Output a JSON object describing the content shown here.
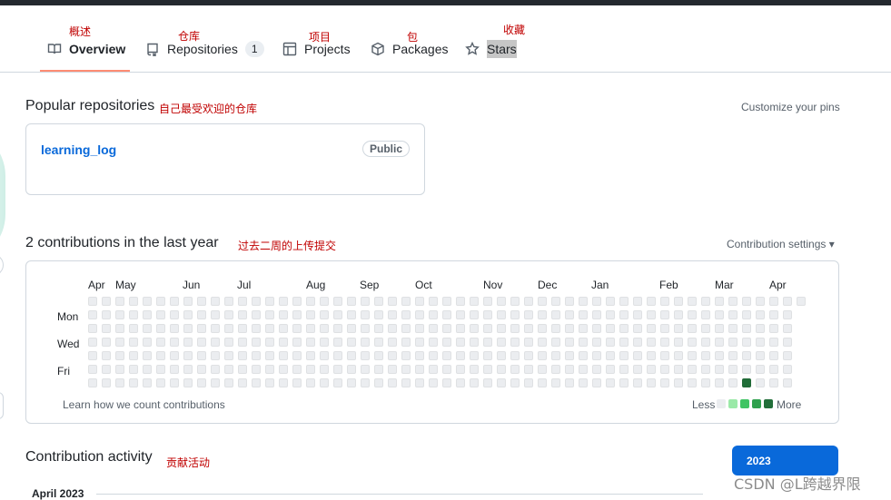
{
  "nav": {
    "tabs": [
      {
        "label": "Overview",
        "annotation": "概述"
      },
      {
        "label": "Repositories",
        "count": "1",
        "annotation": "仓库"
      },
      {
        "label": "Projects",
        "annotation": "项目"
      },
      {
        "label": "Packages",
        "annotation": "包"
      },
      {
        "label": "Stars",
        "annotation": "收藏"
      }
    ]
  },
  "popular": {
    "title": "Popular repositories",
    "annotation": "自己最受欢迎的仓库",
    "customize": "Customize your pins",
    "repo": {
      "name": "learning_log",
      "visibility": "Public"
    }
  },
  "contributions": {
    "title": "2 contributions in the last year",
    "annotation": "过去二周的上传提交",
    "settings": "Contribution settings ▾",
    "months": [
      "Apr",
      "May",
      "Jun",
      "Jul",
      "Aug",
      "Sep",
      "Oct",
      "Nov",
      "Dec",
      "Jan",
      "Feb",
      "Mar",
      "Apr"
    ],
    "days": [
      "Mon",
      "Wed",
      "Fri"
    ],
    "learn": "Learn how we count contributions",
    "legend_less": "Less",
    "legend_more": "More",
    "active_cell_color": "#216e39",
    "legend_colors": [
      "#ebedf0",
      "#9be9a8",
      "#40c463",
      "#30a14e",
      "#216e39"
    ]
  },
  "activity": {
    "title": "Contribution activity",
    "annotation": "贡献活动",
    "year_button": "2023",
    "month_heading": "April 2023"
  },
  "watermark": "CSDN @L跨越界限"
}
